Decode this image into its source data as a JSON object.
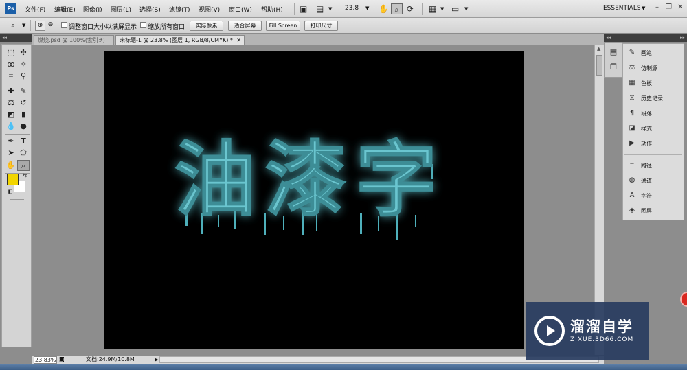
{
  "app": {
    "logo_text": "Ps"
  },
  "menu": [
    "文件(F)",
    "编辑(E)",
    "图像(I)",
    "图层(L)",
    "选择(S)",
    "滤镜(T)",
    "视图(V)",
    "窗口(W)",
    "帮助(H)"
  ],
  "menubar": {
    "zoom": "23.8",
    "workspace": "ESSENTIALS"
  },
  "options": {
    "resize_windows": "调整窗口大小以满屏显示",
    "zoom_all": "缩放所有窗口",
    "actual_pixels": "实际像素",
    "fit_screen": "适合屏幕",
    "fill_screen": "Fill Screen",
    "print_size": "打印尺寸"
  },
  "tabs": [
    {
      "label": "燃烧.psd @ 100%(索引#)",
      "active": false
    },
    {
      "label": "未标题-1 @ 23.8% (图层 1, RGB/8/CMYK) *",
      "active": true
    }
  ],
  "canvas": {
    "text": "油漆字",
    "text_color": "#6bc5cf",
    "background": "#000000"
  },
  "status": {
    "zoom": "23.83%",
    "doc_info": "文档:24.9M/10.8M"
  },
  "toolbox": {
    "foreground_color": "#f2d500",
    "background_color": "#ffffff"
  },
  "panels": [
    {
      "label": "画笔",
      "icon": "brush-icon"
    },
    {
      "label": "仿制源",
      "icon": "clone-source-icon"
    },
    {
      "label": "色板",
      "icon": "swatches-icon"
    },
    {
      "label": "历史记录",
      "icon": "history-icon"
    },
    {
      "label": "段落",
      "icon": "paragraph-icon"
    },
    {
      "label": "样式",
      "icon": "styles-icon"
    },
    {
      "label": "动作",
      "icon": "actions-icon"
    },
    {
      "label": "路径",
      "icon": "paths-icon"
    },
    {
      "label": "通道",
      "icon": "channels-icon"
    },
    {
      "label": "字符",
      "icon": "character-icon"
    },
    {
      "label": "图层",
      "icon": "layers-icon"
    }
  ],
  "watermark": {
    "title": "溜溜自学",
    "url": "ZIXUE.3D66.COM"
  }
}
